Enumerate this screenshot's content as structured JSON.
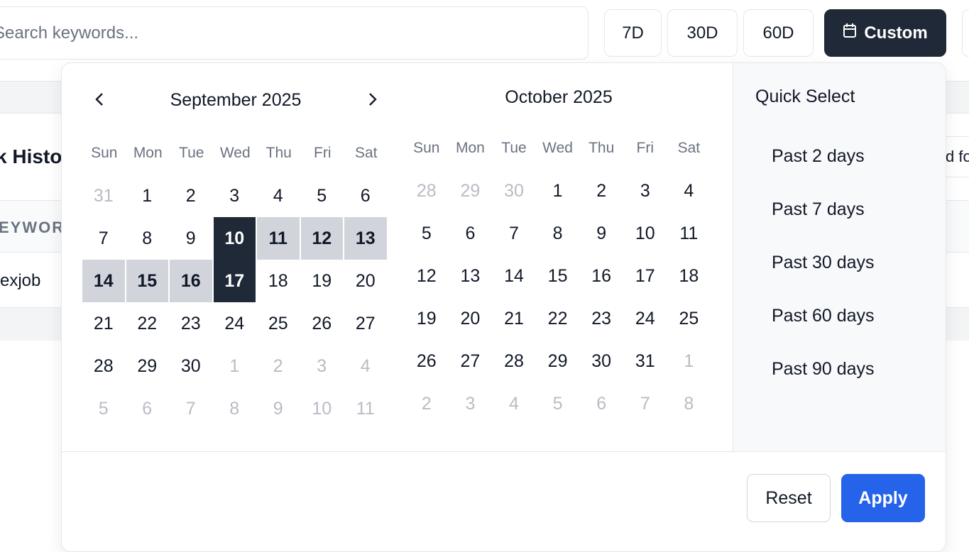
{
  "search": {
    "placeholder": "Search keywords..."
  },
  "range_buttons": {
    "d7": "7D",
    "d30": "30D",
    "d60": "60D",
    "custom": "Custom"
  },
  "background": {
    "section_title": "k History",
    "column_header": "EYWORD",
    "row_keyword": "exjob",
    "right_button_text": "d fo"
  },
  "calendar": {
    "weekdays": [
      "Sun",
      "Mon",
      "Tue",
      "Wed",
      "Thu",
      "Fri",
      "Sat"
    ],
    "left_month": {
      "title": "September 2025",
      "days": [
        {
          "d": "31",
          "s": "muted"
        },
        {
          "d": "1",
          "s": ""
        },
        {
          "d": "2",
          "s": ""
        },
        {
          "d": "3",
          "s": ""
        },
        {
          "d": "4",
          "s": ""
        },
        {
          "d": "5",
          "s": ""
        },
        {
          "d": "6",
          "s": ""
        },
        {
          "d": "7",
          "s": ""
        },
        {
          "d": "8",
          "s": ""
        },
        {
          "d": "9",
          "s": ""
        },
        {
          "d": "10",
          "s": "sel"
        },
        {
          "d": "11",
          "s": "inrange"
        },
        {
          "d": "12",
          "s": "inrange"
        },
        {
          "d": "13",
          "s": "inrange"
        },
        {
          "d": "14",
          "s": "inrange"
        },
        {
          "d": "15",
          "s": "inrange"
        },
        {
          "d": "16",
          "s": "inrange"
        },
        {
          "d": "17",
          "s": "sel"
        },
        {
          "d": "18",
          "s": ""
        },
        {
          "d": "19",
          "s": ""
        },
        {
          "d": "20",
          "s": ""
        },
        {
          "d": "21",
          "s": ""
        },
        {
          "d": "22",
          "s": ""
        },
        {
          "d": "23",
          "s": ""
        },
        {
          "d": "24",
          "s": ""
        },
        {
          "d": "25",
          "s": ""
        },
        {
          "d": "26",
          "s": ""
        },
        {
          "d": "27",
          "s": ""
        },
        {
          "d": "28",
          "s": ""
        },
        {
          "d": "29",
          "s": ""
        },
        {
          "d": "30",
          "s": ""
        },
        {
          "d": "1",
          "s": "muted"
        },
        {
          "d": "2",
          "s": "muted"
        },
        {
          "d": "3",
          "s": "muted"
        },
        {
          "d": "4",
          "s": "muted"
        },
        {
          "d": "5",
          "s": "muted"
        },
        {
          "d": "6",
          "s": "muted"
        },
        {
          "d": "7",
          "s": "muted"
        },
        {
          "d": "8",
          "s": "muted"
        },
        {
          "d": "9",
          "s": "muted"
        },
        {
          "d": "10",
          "s": "muted"
        },
        {
          "d": "11",
          "s": "muted"
        }
      ]
    },
    "right_month": {
      "title": "October 2025",
      "days": [
        {
          "d": "28",
          "s": "muted"
        },
        {
          "d": "29",
          "s": "muted"
        },
        {
          "d": "30",
          "s": "muted"
        },
        {
          "d": "1",
          "s": ""
        },
        {
          "d": "2",
          "s": ""
        },
        {
          "d": "3",
          "s": ""
        },
        {
          "d": "4",
          "s": ""
        },
        {
          "d": "5",
          "s": ""
        },
        {
          "d": "6",
          "s": ""
        },
        {
          "d": "7",
          "s": ""
        },
        {
          "d": "8",
          "s": ""
        },
        {
          "d": "9",
          "s": ""
        },
        {
          "d": "10",
          "s": ""
        },
        {
          "d": "11",
          "s": ""
        },
        {
          "d": "12",
          "s": ""
        },
        {
          "d": "13",
          "s": ""
        },
        {
          "d": "14",
          "s": ""
        },
        {
          "d": "15",
          "s": ""
        },
        {
          "d": "16",
          "s": ""
        },
        {
          "d": "17",
          "s": ""
        },
        {
          "d": "18",
          "s": ""
        },
        {
          "d": "19",
          "s": ""
        },
        {
          "d": "20",
          "s": ""
        },
        {
          "d": "21",
          "s": ""
        },
        {
          "d": "22",
          "s": ""
        },
        {
          "d": "23",
          "s": ""
        },
        {
          "d": "24",
          "s": ""
        },
        {
          "d": "25",
          "s": ""
        },
        {
          "d": "26",
          "s": ""
        },
        {
          "d": "27",
          "s": ""
        },
        {
          "d": "28",
          "s": ""
        },
        {
          "d": "29",
          "s": ""
        },
        {
          "d": "30",
          "s": ""
        },
        {
          "d": "31",
          "s": ""
        },
        {
          "d": "1",
          "s": "muted"
        },
        {
          "d": "2",
          "s": "muted"
        },
        {
          "d": "3",
          "s": "muted"
        },
        {
          "d": "4",
          "s": "muted"
        },
        {
          "d": "5",
          "s": "muted"
        },
        {
          "d": "6",
          "s": "muted"
        },
        {
          "d": "7",
          "s": "muted"
        },
        {
          "d": "8",
          "s": "muted"
        }
      ]
    },
    "selected_start": "10",
    "selected_end": "17"
  },
  "quick_select": {
    "title": "Quick Select",
    "items": [
      "Past 2 days",
      "Past 7 days",
      "Past 30 days",
      "Past 60 days",
      "Past 90 days"
    ]
  },
  "footer": {
    "reset": "Reset",
    "apply": "Apply"
  },
  "colors": {
    "dark": "#1f2937",
    "range": "#d1d5db",
    "accent": "#2563eb",
    "muted_text": "#b8bcc4"
  },
  "icons": {
    "prev": "chevron-left-icon",
    "next": "chevron-right-icon",
    "custom": "calendar-icon"
  }
}
